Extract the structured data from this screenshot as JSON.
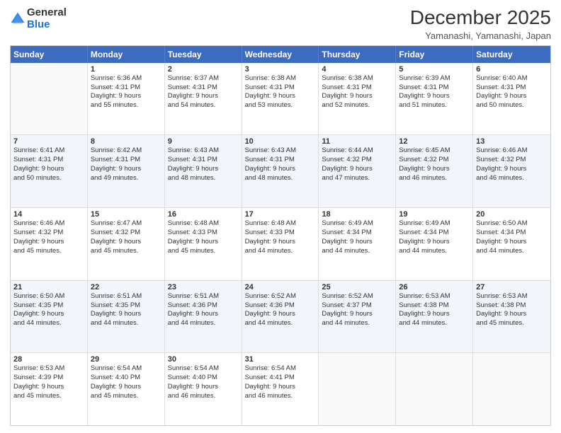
{
  "logo": {
    "line1": "General",
    "line2": "Blue"
  },
  "title": "December 2025",
  "subtitle": "Yamanashi, Yamanashi, Japan",
  "header_days": [
    "Sunday",
    "Monday",
    "Tuesday",
    "Wednesday",
    "Thursday",
    "Friday",
    "Saturday"
  ],
  "weeks": [
    [
      {
        "day": "",
        "lines": []
      },
      {
        "day": "1",
        "lines": [
          "Sunrise: 6:36 AM",
          "Sunset: 4:31 PM",
          "Daylight: 9 hours",
          "and 55 minutes."
        ]
      },
      {
        "day": "2",
        "lines": [
          "Sunrise: 6:37 AM",
          "Sunset: 4:31 PM",
          "Daylight: 9 hours",
          "and 54 minutes."
        ]
      },
      {
        "day": "3",
        "lines": [
          "Sunrise: 6:38 AM",
          "Sunset: 4:31 PM",
          "Daylight: 9 hours",
          "and 53 minutes."
        ]
      },
      {
        "day": "4",
        "lines": [
          "Sunrise: 6:38 AM",
          "Sunset: 4:31 PM",
          "Daylight: 9 hours",
          "and 52 minutes."
        ]
      },
      {
        "day": "5",
        "lines": [
          "Sunrise: 6:39 AM",
          "Sunset: 4:31 PM",
          "Daylight: 9 hours",
          "and 51 minutes."
        ]
      },
      {
        "day": "6",
        "lines": [
          "Sunrise: 6:40 AM",
          "Sunset: 4:31 PM",
          "Daylight: 9 hours",
          "and 50 minutes."
        ]
      }
    ],
    [
      {
        "day": "7",
        "lines": [
          "Sunrise: 6:41 AM",
          "Sunset: 4:31 PM",
          "Daylight: 9 hours",
          "and 50 minutes."
        ]
      },
      {
        "day": "8",
        "lines": [
          "Sunrise: 6:42 AM",
          "Sunset: 4:31 PM",
          "Daylight: 9 hours",
          "and 49 minutes."
        ]
      },
      {
        "day": "9",
        "lines": [
          "Sunrise: 6:43 AM",
          "Sunset: 4:31 PM",
          "Daylight: 9 hours",
          "and 48 minutes."
        ]
      },
      {
        "day": "10",
        "lines": [
          "Sunrise: 6:43 AM",
          "Sunset: 4:31 PM",
          "Daylight: 9 hours",
          "and 48 minutes."
        ]
      },
      {
        "day": "11",
        "lines": [
          "Sunrise: 6:44 AM",
          "Sunset: 4:32 PM",
          "Daylight: 9 hours",
          "and 47 minutes."
        ]
      },
      {
        "day": "12",
        "lines": [
          "Sunrise: 6:45 AM",
          "Sunset: 4:32 PM",
          "Daylight: 9 hours",
          "and 46 minutes."
        ]
      },
      {
        "day": "13",
        "lines": [
          "Sunrise: 6:46 AM",
          "Sunset: 4:32 PM",
          "Daylight: 9 hours",
          "and 46 minutes."
        ]
      }
    ],
    [
      {
        "day": "14",
        "lines": [
          "Sunrise: 6:46 AM",
          "Sunset: 4:32 PM",
          "Daylight: 9 hours",
          "and 45 minutes."
        ]
      },
      {
        "day": "15",
        "lines": [
          "Sunrise: 6:47 AM",
          "Sunset: 4:32 PM",
          "Daylight: 9 hours",
          "and 45 minutes."
        ]
      },
      {
        "day": "16",
        "lines": [
          "Sunrise: 6:48 AM",
          "Sunset: 4:33 PM",
          "Daylight: 9 hours",
          "and 45 minutes."
        ]
      },
      {
        "day": "17",
        "lines": [
          "Sunrise: 6:48 AM",
          "Sunset: 4:33 PM",
          "Daylight: 9 hours",
          "and 44 minutes."
        ]
      },
      {
        "day": "18",
        "lines": [
          "Sunrise: 6:49 AM",
          "Sunset: 4:34 PM",
          "Daylight: 9 hours",
          "and 44 minutes."
        ]
      },
      {
        "day": "19",
        "lines": [
          "Sunrise: 6:49 AM",
          "Sunset: 4:34 PM",
          "Daylight: 9 hours",
          "and 44 minutes."
        ]
      },
      {
        "day": "20",
        "lines": [
          "Sunrise: 6:50 AM",
          "Sunset: 4:34 PM",
          "Daylight: 9 hours",
          "and 44 minutes."
        ]
      }
    ],
    [
      {
        "day": "21",
        "lines": [
          "Sunrise: 6:50 AM",
          "Sunset: 4:35 PM",
          "Daylight: 9 hours",
          "and 44 minutes."
        ]
      },
      {
        "day": "22",
        "lines": [
          "Sunrise: 6:51 AM",
          "Sunset: 4:35 PM",
          "Daylight: 9 hours",
          "and 44 minutes."
        ]
      },
      {
        "day": "23",
        "lines": [
          "Sunrise: 6:51 AM",
          "Sunset: 4:36 PM",
          "Daylight: 9 hours",
          "and 44 minutes."
        ]
      },
      {
        "day": "24",
        "lines": [
          "Sunrise: 6:52 AM",
          "Sunset: 4:36 PM",
          "Daylight: 9 hours",
          "and 44 minutes."
        ]
      },
      {
        "day": "25",
        "lines": [
          "Sunrise: 6:52 AM",
          "Sunset: 4:37 PM",
          "Daylight: 9 hours",
          "and 44 minutes."
        ]
      },
      {
        "day": "26",
        "lines": [
          "Sunrise: 6:53 AM",
          "Sunset: 4:38 PM",
          "Daylight: 9 hours",
          "and 44 minutes."
        ]
      },
      {
        "day": "27",
        "lines": [
          "Sunrise: 6:53 AM",
          "Sunset: 4:38 PM",
          "Daylight: 9 hours",
          "and 45 minutes."
        ]
      }
    ],
    [
      {
        "day": "28",
        "lines": [
          "Sunrise: 6:53 AM",
          "Sunset: 4:39 PM",
          "Daylight: 9 hours",
          "and 45 minutes."
        ]
      },
      {
        "day": "29",
        "lines": [
          "Sunrise: 6:54 AM",
          "Sunset: 4:40 PM",
          "Daylight: 9 hours",
          "and 45 minutes."
        ]
      },
      {
        "day": "30",
        "lines": [
          "Sunrise: 6:54 AM",
          "Sunset: 4:40 PM",
          "Daylight: 9 hours",
          "and 46 minutes."
        ]
      },
      {
        "day": "31",
        "lines": [
          "Sunrise: 6:54 AM",
          "Sunset: 4:41 PM",
          "Daylight: 9 hours",
          "and 46 minutes."
        ]
      },
      {
        "day": "",
        "lines": []
      },
      {
        "day": "",
        "lines": []
      },
      {
        "day": "",
        "lines": []
      }
    ]
  ]
}
